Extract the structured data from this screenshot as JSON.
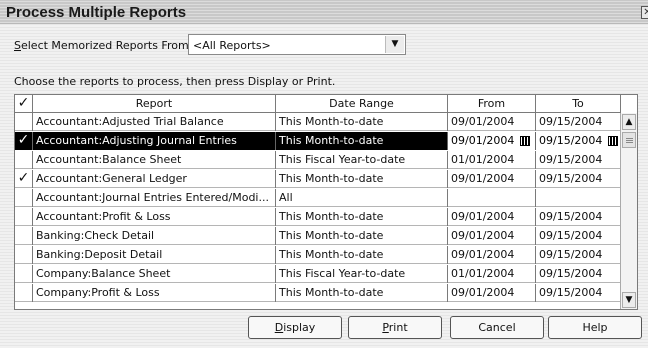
{
  "window": {
    "title": "Process Multiple Reports",
    "close": "✕"
  },
  "filter": {
    "label_pre": "",
    "label_u": "S",
    "label_post": "elect Memorized Reports From",
    "value": "<All Reports>"
  },
  "instructions": "Choose the reports to process, then press Display or Print.",
  "columns": {
    "check": "✓",
    "report": "Report",
    "range": "Date Range",
    "from": "From",
    "to": "To"
  },
  "rows": [
    {
      "checked": "",
      "report": "Accountant:Adjusted Trial Balance",
      "range": "This Month-to-date",
      "from": "09/01/2004",
      "to": "09/15/2004"
    },
    {
      "checked": "✓",
      "report": "Accountant:Adjusting Journal Entries",
      "range": "This Month-to-date",
      "from": "09/01/2004",
      "to": "09/15/2004"
    },
    {
      "checked": "",
      "report": "Accountant:Balance Sheet",
      "range": "This Fiscal Year-to-date",
      "from": "01/01/2004",
      "to": "09/15/2004"
    },
    {
      "checked": "✓",
      "report": "Accountant:General Ledger",
      "range": "This Month-to-date",
      "from": "09/01/2004",
      "to": "09/15/2004"
    },
    {
      "checked": "",
      "report": "Accountant:Journal Entries Entered/Modi...",
      "range": "All",
      "from": "",
      "to": ""
    },
    {
      "checked": "",
      "report": "Accountant:Profit & Loss",
      "range": "This Month-to-date",
      "from": "09/01/2004",
      "to": "09/15/2004"
    },
    {
      "checked": "",
      "report": "Banking:Check Detail",
      "range": "This Month-to-date",
      "from": "09/01/2004",
      "to": "09/15/2004"
    },
    {
      "checked": "",
      "report": "Banking:Deposit Detail",
      "range": "This Month-to-date",
      "from": "09/01/2004",
      "to": "09/15/2004"
    },
    {
      "checked": "",
      "report": "Company:Balance Sheet",
      "range": "This Fiscal Year-to-date",
      "from": "01/01/2004",
      "to": "09/15/2004"
    },
    {
      "checked": "",
      "report": "Company:Profit & Loss",
      "range": "This Month-to-date",
      "from": "09/01/2004",
      "to": "09/15/2004"
    }
  ],
  "buttons": {
    "display": {
      "u": "D",
      "rest": "isplay"
    },
    "print": {
      "u": "P",
      "rest": "rint"
    },
    "cancel": "Cancel",
    "help": "Help"
  },
  "icons": {
    "dropdown": "chevron-down-icon",
    "calendar": "calendar-icon",
    "scroll_up": "▲",
    "scroll_down": "▼",
    "select_arrow": "▼"
  },
  "colors": {
    "selected_row": "#000000",
    "selected_text": "#ffffff"
  }
}
